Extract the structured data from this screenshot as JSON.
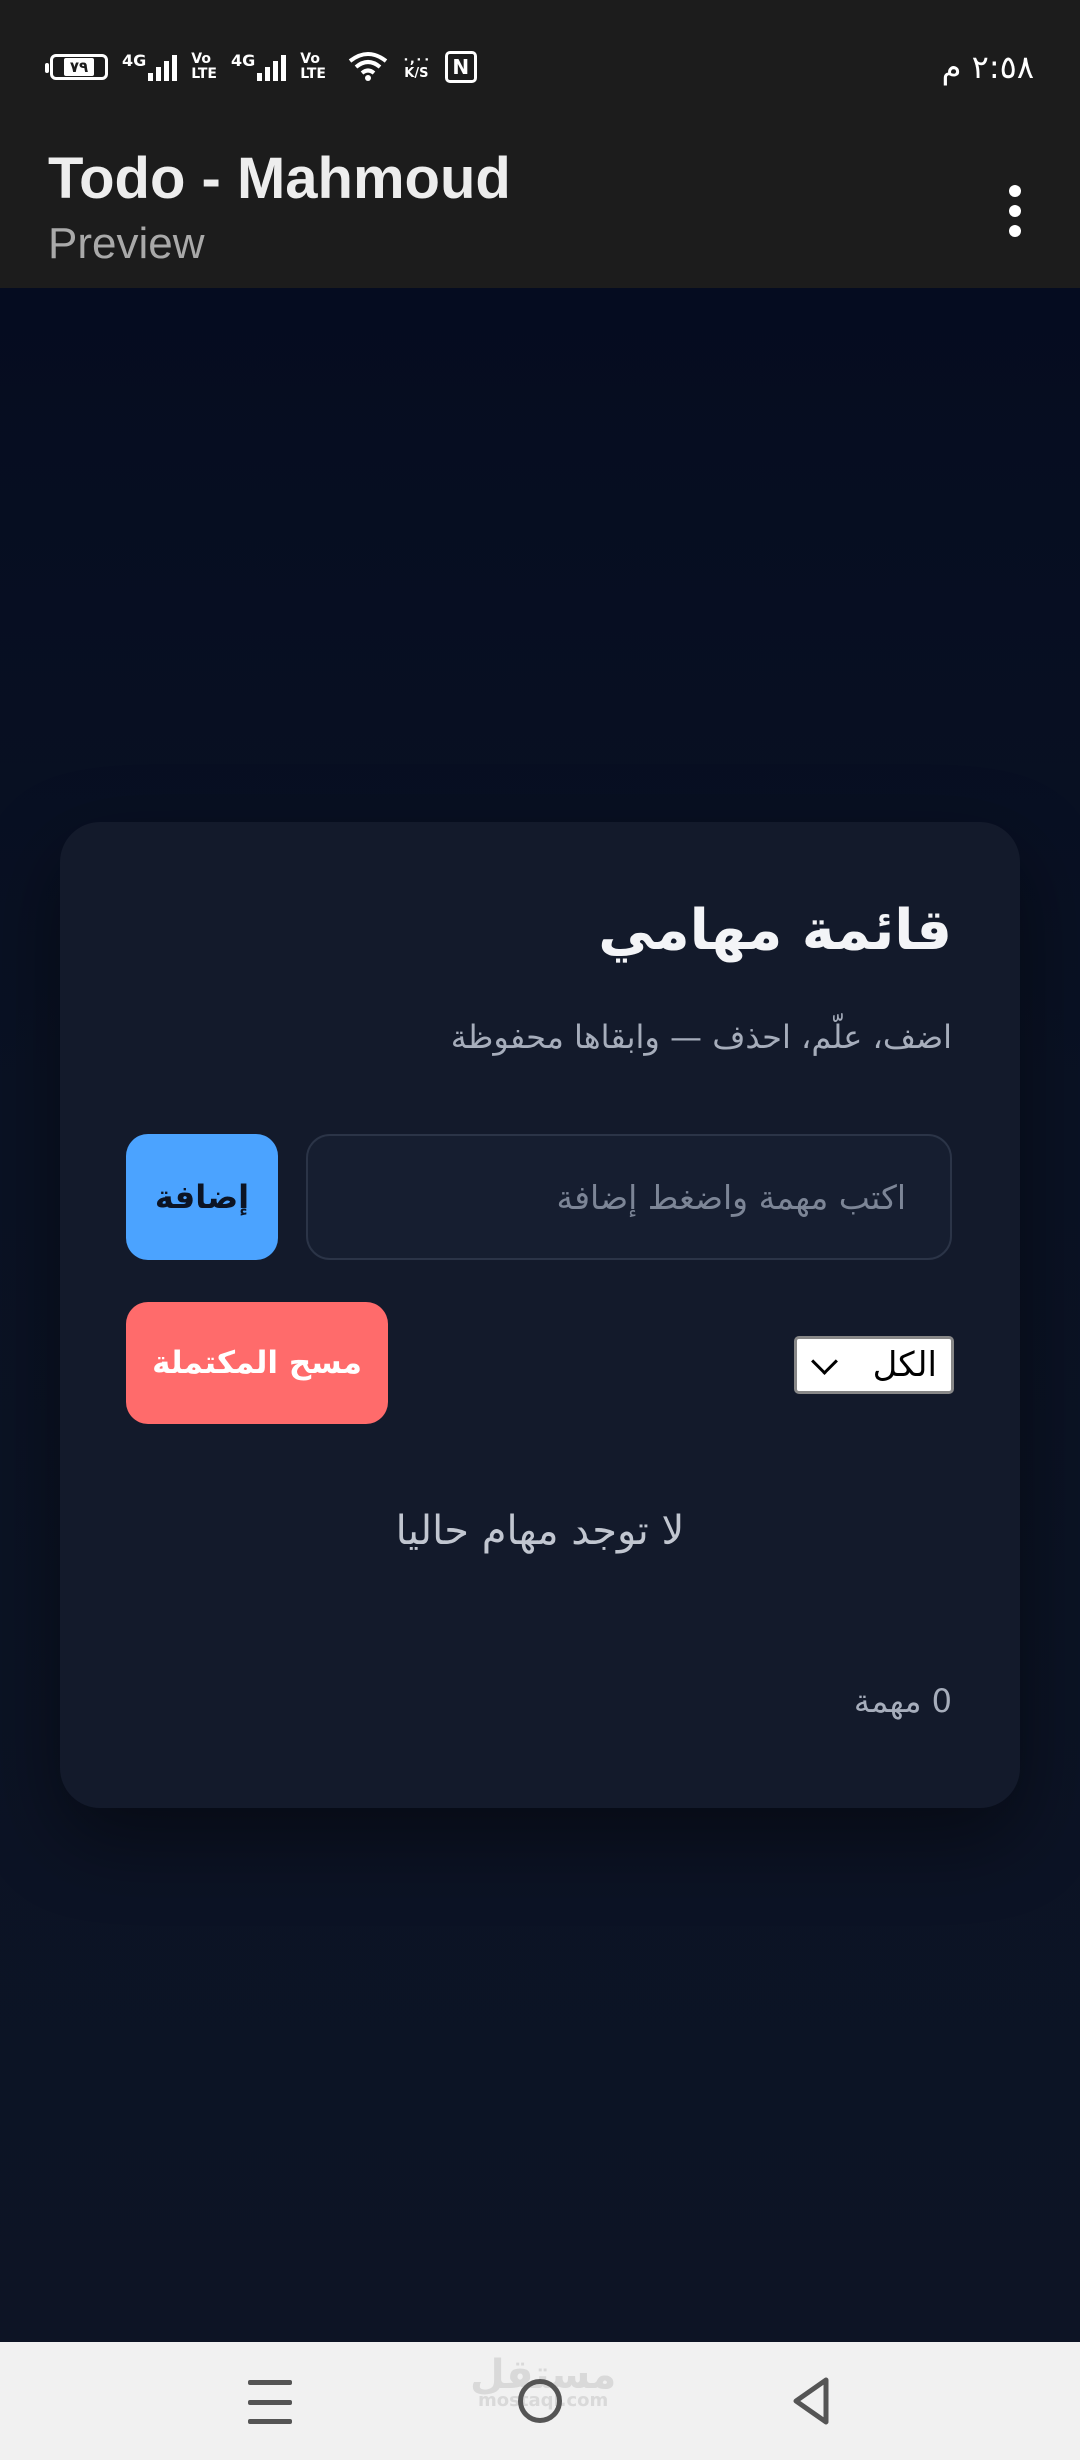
{
  "status_bar": {
    "battery_level": "٧٩",
    "network1": "4G",
    "volte1_top": "Vo",
    "volte1_bottom": "LTE",
    "network2": "4G",
    "volte2_top": "Vo",
    "volte2_bottom": "LTE",
    "speed_value": "٠,٠٠",
    "speed_unit": "K/S",
    "nfc": "N",
    "time": "٢:٥٨ م"
  },
  "app_bar": {
    "title": "Todo - Mahmoud",
    "subtitle": "Preview"
  },
  "card": {
    "title": "قائمة مهامي",
    "subtitle": "اضف، علّم، احذف — وابقاها محفوظة",
    "input_placeholder": "اكتب مهمة واضغط إضافة",
    "input_value": "",
    "add_label": "إضافة",
    "filter_selected": "الكل",
    "clear_completed_label": "مسح المكتملة",
    "empty_message": "لا توجد مهام حاليا",
    "task_count": "0 مهمة"
  },
  "watermark": {
    "text": "مستقل",
    "domain": "mostaql.com"
  },
  "colors": {
    "add_button": "#4ba3ff",
    "clear_button": "#ff6b6b",
    "card_bg": "#131a2b",
    "page_bg": "#0b1120"
  },
  "icons": [
    "battery-icon",
    "signal-icon",
    "wifi-icon",
    "nfc-icon",
    "more-vert-icon",
    "chevron-down-icon",
    "recents-icon",
    "home-icon",
    "back-icon"
  ]
}
